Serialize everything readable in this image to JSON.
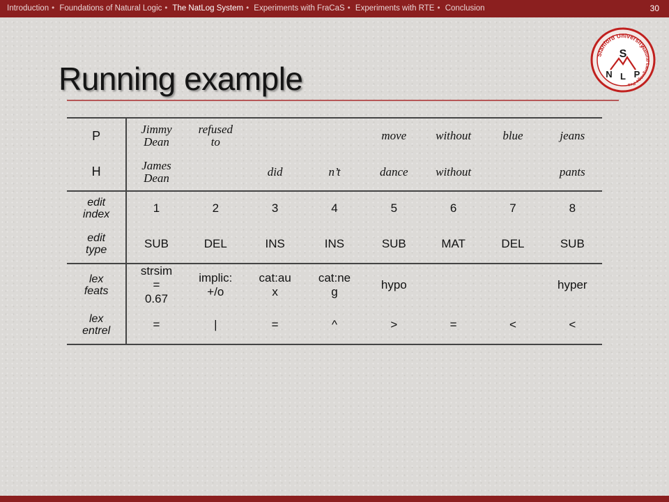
{
  "nav": {
    "items": [
      {
        "label": "Introduction",
        "active": false
      },
      {
        "label": "Foundations of Natural Logic",
        "active": false
      },
      {
        "label": "The NatLog System",
        "active": true
      },
      {
        "label": "Experiments with FraCaS",
        "active": false
      },
      {
        "label": "Experiments with RTE",
        "active": false
      },
      {
        "label": "Conclusion",
        "active": false
      }
    ],
    "separator": "•"
  },
  "page_number": "30",
  "title": "Running example",
  "logo": {
    "top_text": "Stanford University",
    "side_text": "Natural Language Processing",
    "letters": [
      "S",
      "N",
      "L",
      "P"
    ],
    "color": "#c0201e"
  },
  "table": {
    "row_labels": {
      "p": "P",
      "h": "H",
      "edit_index": [
        "edit",
        "index"
      ],
      "edit_type": [
        "edit",
        "type"
      ],
      "lex_feats": [
        "lex",
        "feats"
      ],
      "lex_entrel": [
        "lex",
        "entrel"
      ]
    },
    "p_words": [
      [
        "Jimmy",
        "Dean"
      ],
      [
        "refused",
        "to"
      ],
      "",
      "",
      "move",
      "without",
      "blue",
      "jeans"
    ],
    "h_words": [
      [
        "James",
        "Dean"
      ],
      "",
      "did",
      "n’t",
      "dance",
      "without",
      "",
      "pants"
    ],
    "edit_index": [
      "1",
      "2",
      "3",
      "4",
      "5",
      "6",
      "7",
      "8"
    ],
    "edit_type": [
      "SUB",
      "DEL",
      "INS",
      "INS",
      "SUB",
      "MAT",
      "DEL",
      "SUB"
    ],
    "lex_feats": [
      [
        "strsim",
        "=",
        "0.67"
      ],
      [
        "implic:",
        "+/o"
      ],
      [
        "cat:au",
        "x"
      ],
      [
        "cat:ne",
        "g"
      ],
      "hypo",
      "",
      "",
      "hyper"
    ],
    "lex_entrel": [
      "=",
      "|",
      "=",
      "^",
      ">",
      "=",
      "<",
      "<"
    ]
  },
  "colors": {
    "bar": "#8b1f1f",
    "rule": "#b65757"
  }
}
